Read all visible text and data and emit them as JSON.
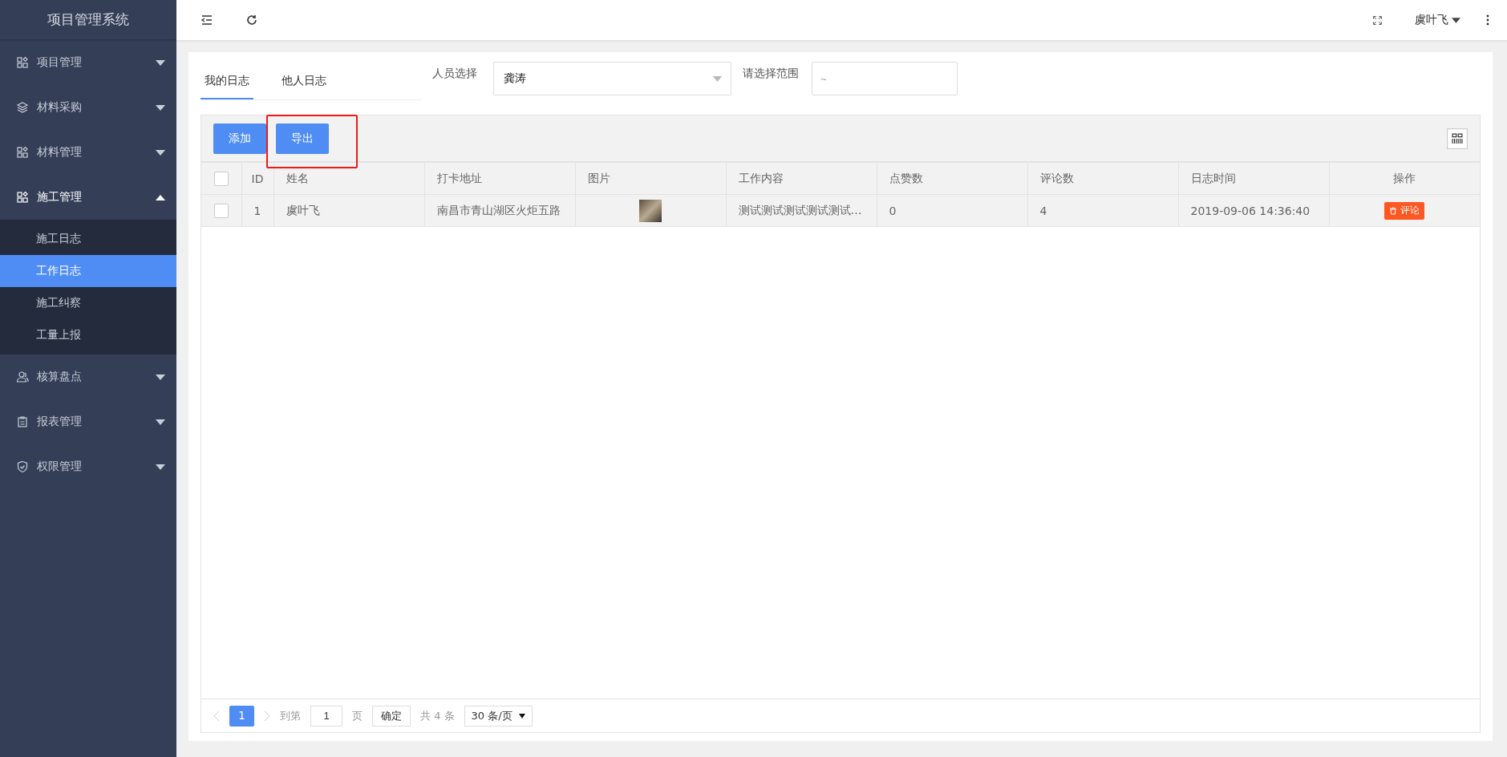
{
  "sidebar": {
    "title": "项目管理系统",
    "items": [
      {
        "label": "项目管理",
        "expanded": false
      },
      {
        "label": "材料采购",
        "expanded": false
      },
      {
        "label": "材料管理",
        "expanded": false
      },
      {
        "label": "施工管理",
        "expanded": true,
        "children": [
          {
            "label": "施工日志",
            "selected": false
          },
          {
            "label": "工作日志",
            "selected": true
          },
          {
            "label": "施工纠察",
            "selected": false
          },
          {
            "label": "工量上报",
            "selected": false
          }
        ]
      },
      {
        "label": "核算盘点",
        "expanded": false
      },
      {
        "label": "报表管理",
        "expanded": false
      },
      {
        "label": "权限管理",
        "expanded": false
      }
    ]
  },
  "header": {
    "user": "虞叶飞"
  },
  "tabs": [
    {
      "label": "我的日志",
      "selected": true
    },
    {
      "label": "他人日志",
      "selected": false
    }
  ],
  "filters": {
    "person_label": "人员选择",
    "person_value": "龚涛",
    "range_label": "请选择范围",
    "range_placeholder": "~"
  },
  "buttons": [
    {
      "label": "添加",
      "highlighted": false
    },
    {
      "label": "导出",
      "highlighted": true
    }
  ],
  "table": {
    "all_checked": false,
    "columns": [
      "ID",
      "姓名",
      "打卡地址",
      "图片",
      "工作内容",
      "点赞数",
      "评论数",
      "日志时间",
      "操作"
    ],
    "rows": [
      {
        "checked": false,
        "cells": [
          "1",
          "虞叶飞",
          "南昌市青山湖区火炬五路",
          "",
          "测试测试测试测试测试…",
          "0",
          "4",
          "2019-09-06 14:36:40"
        ],
        "action": "评论"
      }
    ]
  },
  "pagination": {
    "current": "1",
    "goto_label": "到第",
    "goto_value": "1",
    "page_label": "页",
    "confirm": "确定",
    "total": "共 4 条",
    "page_size": "30 条/页"
  }
}
